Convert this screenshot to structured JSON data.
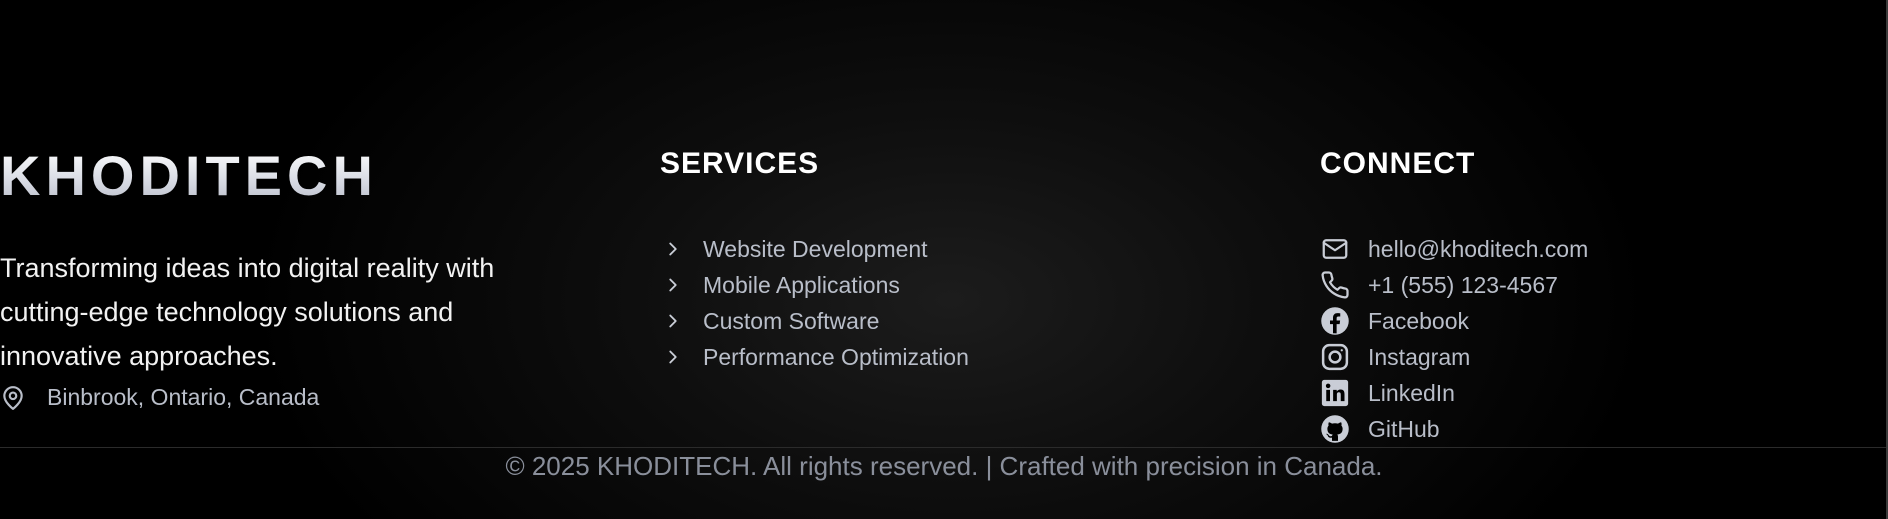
{
  "brand": {
    "name": "KHODITECH",
    "tagline": "Transforming ideas into digital reality with cutting-edge technology solutions and innovative approaches.",
    "location": "Binbrook, Ontario, Canada",
    "location_icon": "map-pin-icon"
  },
  "services": {
    "heading": "SERVICES",
    "items": [
      {
        "label": "Website Development",
        "icon": "chevron-right-icon"
      },
      {
        "label": "Mobile Applications",
        "icon": "chevron-right-icon"
      },
      {
        "label": "Custom Software",
        "icon": "chevron-right-icon"
      },
      {
        "label": "Performance Optimization",
        "icon": "chevron-right-icon"
      }
    ]
  },
  "connect": {
    "heading": "CONNECT",
    "items": [
      {
        "label": "hello@khoditech.com",
        "icon": "mail-icon"
      },
      {
        "label": "+1 (555) 123-4567",
        "icon": "phone-icon"
      },
      {
        "label": "Facebook",
        "icon": "facebook-icon"
      },
      {
        "label": "Instagram",
        "icon": "instagram-icon"
      },
      {
        "label": "LinkedIn",
        "icon": "linkedin-icon"
      },
      {
        "label": "GitHub",
        "icon": "github-icon"
      }
    ]
  },
  "footer": {
    "copyright": "© 2025 KHODITECH. All rights reserved. | Crafted with precision in Canada."
  },
  "colors": {
    "background": "#000000",
    "heading": "#ffffff",
    "link": "#b9bec9",
    "muted": "#8a8f9b"
  }
}
